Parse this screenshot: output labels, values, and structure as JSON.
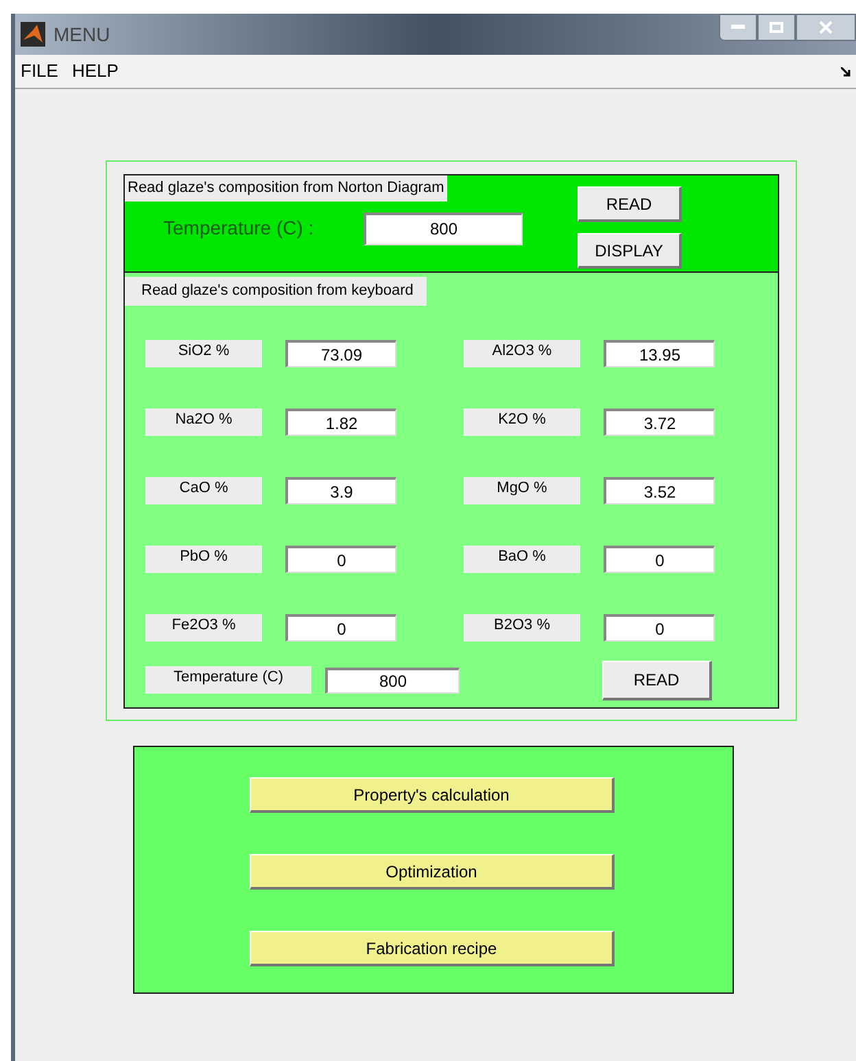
{
  "window": {
    "title": "MENU"
  },
  "menu": [
    "FILE",
    "HELP"
  ],
  "norton": {
    "title": "Read glaze's composition from Norton Diagram",
    "temperature_label": "Temperature (C) :",
    "temperature_value": "800",
    "buttons": [
      "READ",
      "DISPLAY"
    ]
  },
  "keyboard": {
    "title": "Read glaze's composition from keyboard",
    "fields": [
      {
        "label": "SiO2 %",
        "value": "73.09"
      },
      {
        "label": "Al2O3 %",
        "value": "13.95"
      },
      {
        "label": "Na2O %",
        "value": "1.82"
      },
      {
        "label": "K2O %",
        "value": "3.72"
      },
      {
        "label": "CaO %",
        "value": "3.9"
      },
      {
        "label": "MgO %",
        "value": "3.52"
      },
      {
        "label": "PbO %",
        "value": "0"
      },
      {
        "label": "BaO %",
        "value": "0"
      },
      {
        "label": "Fe2O3 %",
        "value": "0"
      },
      {
        "label": "B2O3 %",
        "value": "0"
      }
    ],
    "temperature_label": "Temperature (C)",
    "temperature_value": "800",
    "read_button": "READ"
  },
  "actions": [
    "Property's calculation",
    "Optimization",
    "Fabrication recipe"
  ]
}
